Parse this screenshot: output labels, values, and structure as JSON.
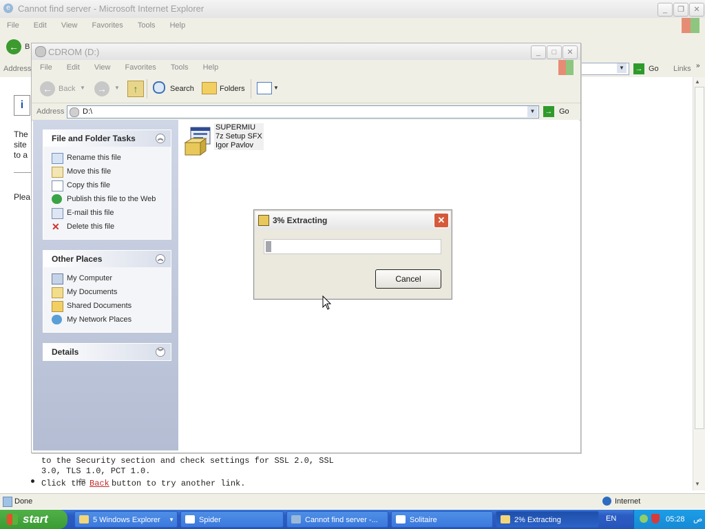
{
  "ie": {
    "title": "Cannot find server - Microsoft Internet Explorer",
    "menu": [
      "File",
      "Edit",
      "View",
      "Favorites",
      "Tools",
      "Help"
    ],
    "back_label": "B",
    "address_label": "Address",
    "go_label": "Go",
    "links_label": "Links",
    "content": {
      "left_fragments": [
        "The",
        "site",
        "to a",
        "Plea"
      ],
      "ssl_line1": "to the Security section and check settings for SSL 2.0, SSL",
      "ssl_line2": "3.0, TLS 1.0, PCT 1.0.",
      "click_pre": "Click the",
      "back_link": "Back",
      "click_post": "button to try another link."
    },
    "status": "Done",
    "zone": "Internet"
  },
  "explorer": {
    "title": "CDROM (D:)",
    "menu": [
      "File",
      "Edit",
      "View",
      "Favorites",
      "Tools",
      "Help"
    ],
    "toolbar": {
      "back": "Back",
      "search": "Search",
      "folders": "Folders"
    },
    "address_label": "Address",
    "address_value": "D:\\",
    "go_label": "Go",
    "tasks": {
      "header": "File and Folder Tasks",
      "items": [
        "Rename this file",
        "Move this file",
        "Copy this file",
        "Publish this file to the Web",
        "E-mail this file",
        "Delete this file"
      ]
    },
    "places": {
      "header": "Other Places",
      "items": [
        "My Computer",
        "My Documents",
        "Shared Documents",
        "My Network Places"
      ]
    },
    "details": {
      "header": "Details"
    },
    "file": {
      "name": "SUPERMIU",
      "type": "7z Setup SFX",
      "author": "Igor Pavlov"
    }
  },
  "dialog": {
    "title": "3% Extracting",
    "progress": 0.03,
    "cancel": "Cancel"
  },
  "taskbar": {
    "start": "start",
    "tasks": [
      "5 Windows Explorer",
      "Spider",
      "Cannot find server -...",
      "Solitaire",
      "2% Extracting"
    ],
    "lang": "EN",
    "clock": "05:28",
    "ampm": "ص"
  }
}
